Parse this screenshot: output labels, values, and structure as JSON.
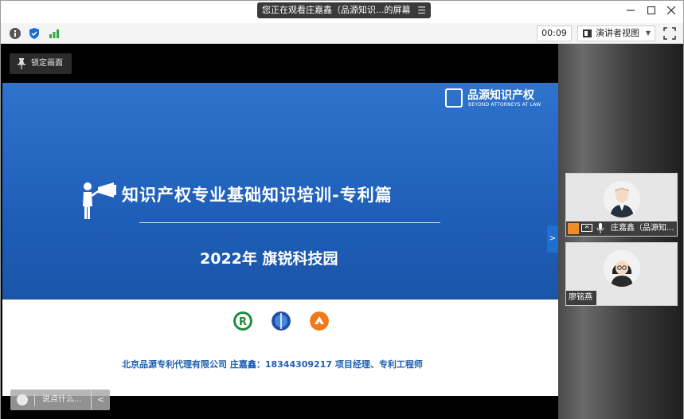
{
  "titlebar": {
    "share_text": "您正在观看庄嘉鑫（品源知识...的屏幕",
    "menu_icon": "list-icon"
  },
  "toolbar": {
    "timer": "00:09",
    "view_label": "演讲者视图",
    "icons": [
      "info-icon",
      "shield-icon",
      "signal-icon",
      "fullscreen-icon"
    ]
  },
  "stage": {
    "lock_label": "锁定画面",
    "comment_placeholder": "说点什么..."
  },
  "slide": {
    "logo_cn": "品源知识产权",
    "logo_en": "BEYOND ATTORNEYS AT LAW",
    "title": "知识产权专业基础知识培训-专利篇",
    "subtitle": "2022年 旗锐科技园",
    "company_line": "北京品源专利代理有限公司   庄嘉鑫：18344309217  项目经理、专利工程师",
    "partner_logo_colors": [
      "#1b8a3a",
      "#1f4fa8",
      "#f07a1a"
    ]
  },
  "participants": [
    {
      "name": "庄嘉鑫（品源知...",
      "role": "host"
    },
    {
      "name": "廖铭燕",
      "role": "attendee"
    }
  ],
  "colors": {
    "slide_blue": "#2563c0",
    "accent_blue": "#1f6fd0",
    "company_text": "#1e5fb0",
    "host_badge": "#f08b2c"
  }
}
